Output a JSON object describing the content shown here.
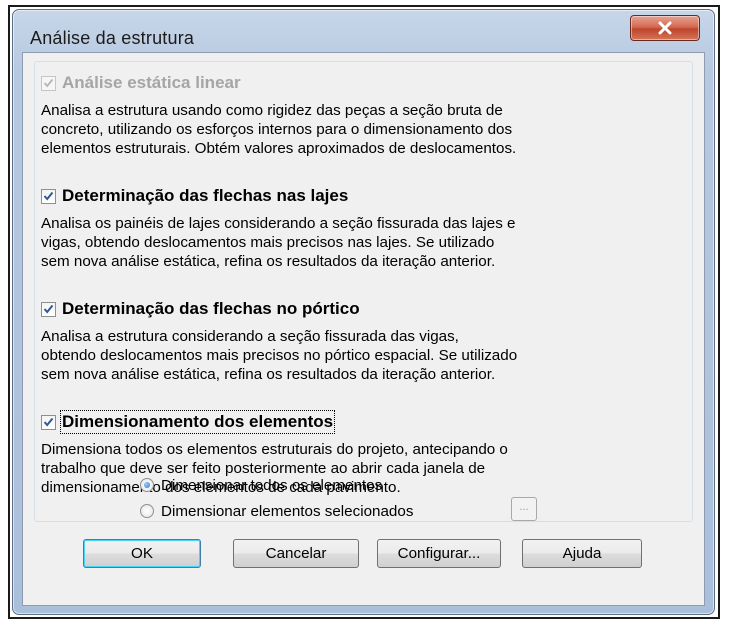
{
  "window": {
    "title": "Análise da estrutura",
    "close_icon": "close-icon"
  },
  "options": [
    {
      "label": "Análise estática linear",
      "checked": true,
      "disabled": true,
      "description": "Analisa a estrutura usando como rigidez das peças a seção bruta de\nconcreto, utilizando os esforços internos para o dimensionamento dos\nelementos estruturais. Obtém valores aproximados de deslocamentos."
    },
    {
      "label": "Determinação das flechas nas lajes",
      "checked": true,
      "disabled": false,
      "description": "Analisa os painéis de lajes considerando a seção fissurada das lajes e\nvigas, obtendo deslocamentos mais precisos nas lajes. Se utilizado\nsem nova análise estática, refina os resultados da iteração anterior."
    },
    {
      "label": "Determinação das flechas no pórtico",
      "checked": true,
      "disabled": false,
      "description": "Analisa a estrutura considerando a seção fissurada das vigas,\nobtendo deslocamentos mais precisos no pórtico espacial. Se utilizado\nsem nova análise estática, refina os resultados da iteração anterior."
    },
    {
      "label": "Dimensionamento dos elementos",
      "checked": true,
      "disabled": false,
      "description": "Dimensiona todos os elementos estruturais do projeto, antecipando o\ntrabalho que deve ser feito posteriormente ao abrir cada janela de\ndimensionamento dos elementos de cada pavimento."
    }
  ],
  "radios": [
    {
      "label": "Dimensionar todos os elementos",
      "selected": true
    },
    {
      "label": "Dimensionar elementos selecionados",
      "selected": false
    }
  ],
  "ellipsis_button": "...",
  "buttons": {
    "ok": "OK",
    "cancel": "Cancelar",
    "configure": "Configurar...",
    "help": "Ajuda"
  }
}
